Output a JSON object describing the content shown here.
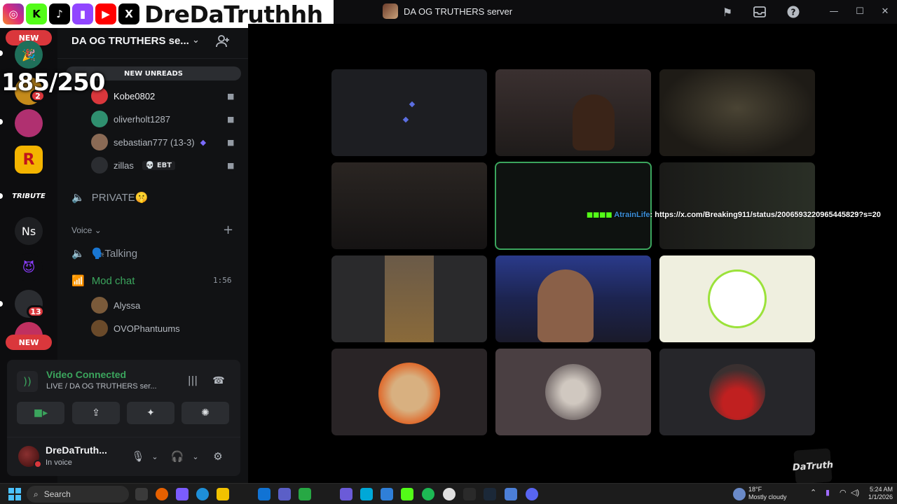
{
  "window": {
    "title": "DA OG TRUTHERS server"
  },
  "overlay": {
    "handle": "DreDaTruthhh",
    "count": "185/250"
  },
  "rail": {
    "new_top": "NEW",
    "new_bottom": "NEW",
    "badge_a": "2",
    "badge_b": "13",
    "tribute": "TRIBUTE",
    "ns": "Ns",
    "rockstar": "R"
  },
  "sidebar": {
    "server_name": "DA OG TRUTHERS se...",
    "new_unreads": "NEW UNREADS",
    "voice_users_top": [
      {
        "name": "Kobe0802"
      },
      {
        "name": "oliverholt1287"
      },
      {
        "name": "sebastian777 (13-3)"
      },
      {
        "name": "zillas",
        "tag": "EBT"
      }
    ],
    "private_channel": "PRIVATE🤫",
    "voice_category": "Voice",
    "talking_channel": "🗣️Talking",
    "mod_channel": "Mod chat",
    "mod_time": "1:56",
    "mod_users": [
      {
        "name": "Alyssa"
      },
      {
        "name": "OVOPhantuums"
      }
    ]
  },
  "voice_panel": {
    "status": "Video Connected",
    "location": "LIVE / DA OG TRUTHERS ser...",
    "user_name": "DreDaTruth...",
    "user_status": "In voice"
  },
  "chat_overlay": {
    "username": "AtrainLife",
    "message": ": https://x.com/Breaking911/status/2006593220965445829?s=20"
  },
  "watermark": "DaTruth",
  "taskbar": {
    "search": "Search",
    "weather_temp": "18°F",
    "weather_desc": "Mostly cloudy",
    "time": "5:24 AM",
    "date": "1/1/2026"
  },
  "colors": {
    "accent_green": "#3ba55d",
    "danger": "#da373c",
    "link_blue": "#3b8ed8"
  }
}
